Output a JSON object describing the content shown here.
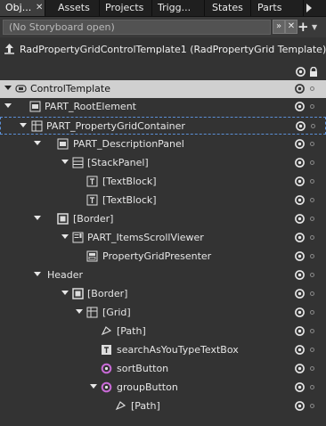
{
  "tabs": [
    {
      "label": "Obj...",
      "icon": "close-icon"
    },
    {
      "label": "Assets"
    },
    {
      "label": "Projects"
    },
    {
      "label": "Trigg..."
    },
    {
      "label": "States"
    },
    {
      "label": "Parts"
    }
  ],
  "storyboard": {
    "placeholder": "(No Storyboard open)",
    "expand_icon": "double-chevron-down-icon",
    "close_icon": "close-icon",
    "add_label": "+",
    "menu_icon": "chevron-down-icon"
  },
  "breadcrumb": {
    "icon": "up-arrow-icon",
    "text": "RadPropertyGridControlTemplate1 (RadPropertyGrid Template)"
  },
  "header_icons": {
    "eye": "eye-icon",
    "lock": "lock-icon"
  },
  "tree": [
    {
      "label": "ControlTemplate",
      "icon": "template-icon",
      "expanded": true,
      "section": true
    },
    {
      "label": "PART_RootElement",
      "icon": "grid-icon",
      "expanded": true
    },
    {
      "label": "PART_PropertyGridContainer",
      "icon": "grid-icon",
      "expanded": true,
      "selected": true
    },
    {
      "label": "PART_DescriptionPanel",
      "icon": "grid-icon",
      "expanded": true
    },
    {
      "label": "[StackPanel]",
      "icon": "stackpanel-icon",
      "expanded": true
    },
    {
      "label": "[TextBlock]",
      "icon": "textblock-icon"
    },
    {
      "label": "[TextBlock]",
      "icon": "textblock-icon"
    },
    {
      "label": "[Border]",
      "icon": "border-icon",
      "expanded": true
    },
    {
      "label": "PART_ItemsScrollViewer",
      "icon": "scrollviewer-icon",
      "expanded": true
    },
    {
      "label": "PropertyGridPresenter",
      "icon": "presenter-icon"
    },
    {
      "label": "Header",
      "icon": "",
      "expanded": true
    },
    {
      "label": "[Border]",
      "icon": "border-icon",
      "expanded": true
    },
    {
      "label": "[Grid]",
      "icon": "grid-icon",
      "expanded": true
    },
    {
      "label": "[Path]",
      "icon": "path-icon"
    },
    {
      "label": "searchAsYouTypeTextBox",
      "icon": "textbox-icon"
    },
    {
      "label": "sortButton",
      "icon": "button-icon"
    },
    {
      "label": "groupButton",
      "icon": "button-icon",
      "expanded": true
    },
    {
      "label": "[Path]",
      "icon": "path-icon"
    }
  ],
  "colors": {
    "section_bg": "#d0d0d0",
    "selection_border": "#5b8fd6",
    "button_icon": "#c86ad6"
  }
}
